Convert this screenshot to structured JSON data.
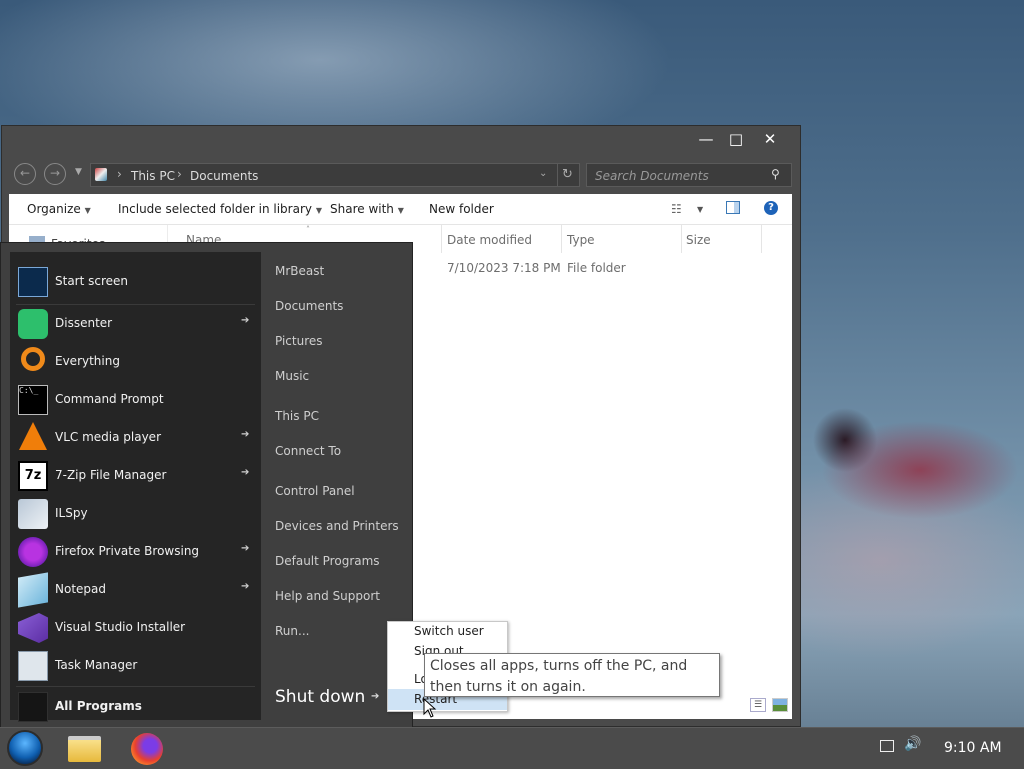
{
  "explorer": {
    "breadcrumb": [
      "This PC",
      "Documents"
    ],
    "search_placeholder": "Search Documents",
    "window_controls": {
      "minimize": "—",
      "maximize": "□",
      "close": "✕"
    },
    "toolbar": {
      "organize": "Organize",
      "include_folder": "Include selected folder in library",
      "share_with": "Share with",
      "new_folder": "New folder"
    },
    "nav_pane_label": "Favorites",
    "columns": [
      "Name",
      "Date modified",
      "Type",
      "Size"
    ],
    "rows": [
      {
        "name": "",
        "date": "7/10/2023 7:18 PM",
        "type": "File folder",
        "size": ""
      }
    ]
  },
  "start_menu": {
    "programs": [
      {
        "label": "Start screen",
        "icon": "start-screen-icon",
        "arrow": false
      },
      {
        "label": "Dissenter",
        "icon": "dissenter-icon",
        "arrow": true
      },
      {
        "label": "Everything",
        "icon": "everything-search-icon",
        "arrow": false
      },
      {
        "label": "Command Prompt",
        "icon": "command-prompt-icon",
        "arrow": false
      },
      {
        "label": "VLC media player",
        "icon": "vlc-icon",
        "arrow": true
      },
      {
        "label": "7-Zip File Manager",
        "icon": "7zip-icon",
        "arrow": true
      },
      {
        "label": "ILSpy",
        "icon": "ilspy-icon",
        "arrow": false
      },
      {
        "label": "Firefox Private Browsing",
        "icon": "firefox-private-icon",
        "arrow": true
      },
      {
        "label": "Notepad",
        "icon": "notepad-icon",
        "arrow": true
      },
      {
        "label": "Visual Studio Installer",
        "icon": "visual-studio-installer-icon",
        "arrow": false
      },
      {
        "label": "Task Manager",
        "icon": "task-manager-icon",
        "arrow": false
      }
    ],
    "all_programs": "All Programs",
    "places": [
      "MrBeast",
      "Documents",
      "Pictures",
      "Music",
      "This PC",
      "Connect To",
      "Control Panel",
      "Devices and Printers",
      "Default Programs",
      "Help and Support",
      "Run..."
    ],
    "shut_down": "Shut down",
    "power_flyout": [
      "Switch user",
      "Sign out",
      "Lock",
      "Restart"
    ],
    "tooltip": "Closes all apps, turns off the PC, and then turns it on again."
  },
  "taskbar": {
    "clock": "9:10 AM"
  },
  "colors": {
    "taskbar": "#4b4b4b",
    "start_menu_left": "#252525",
    "start_menu_right": "#3f3f3f",
    "window_frame": "#4a4a4a"
  }
}
